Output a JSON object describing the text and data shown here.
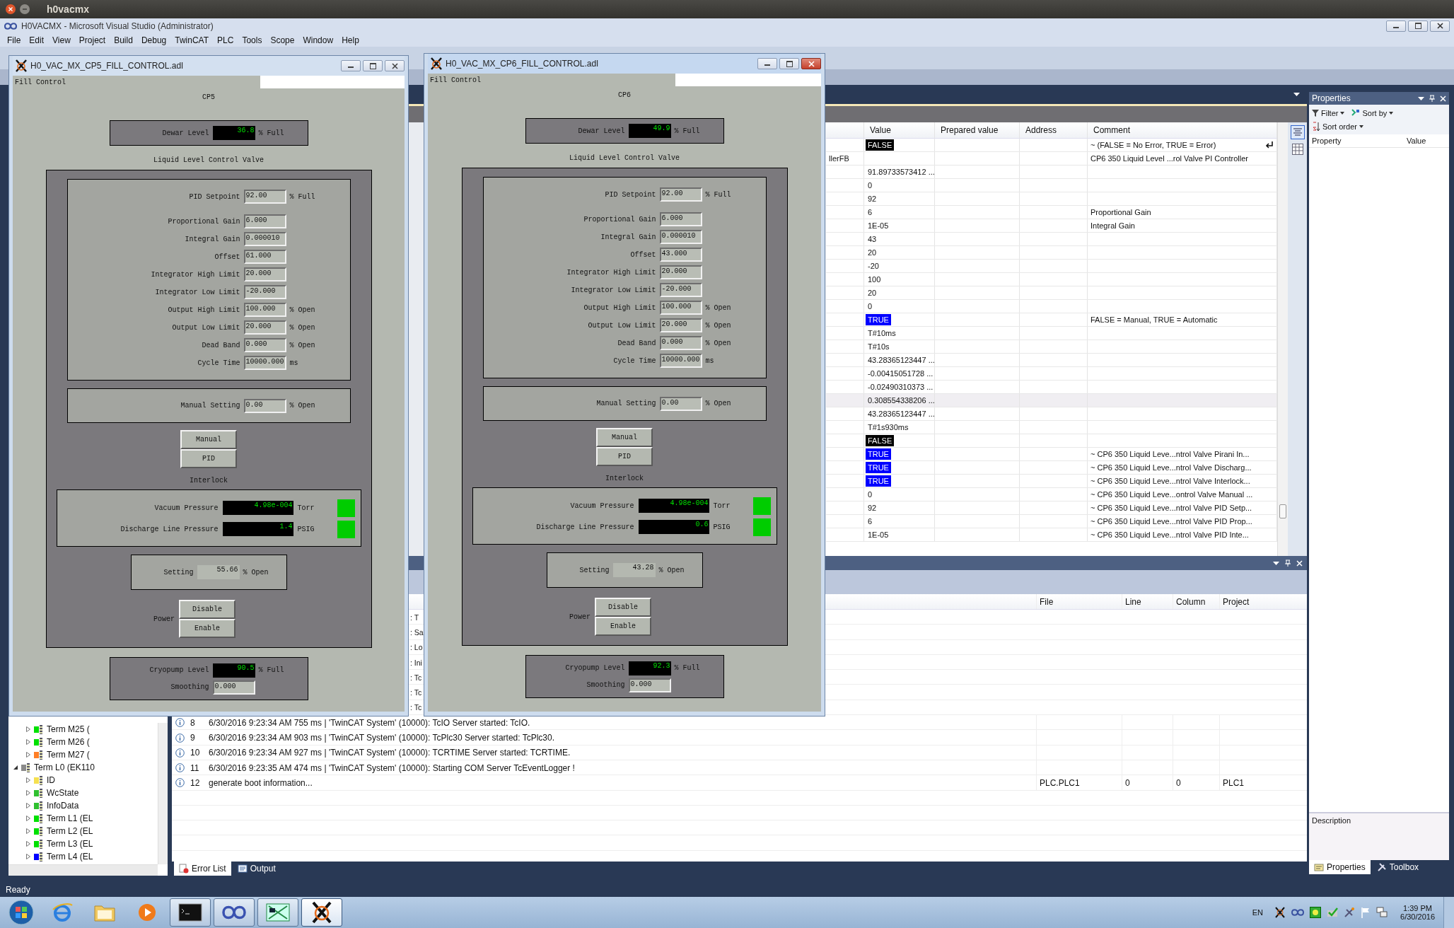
{
  "desktop": {
    "title": "h0vacmx"
  },
  "vs": {
    "title": "H0VACMX - Microsoft Visual Studio (Administrator)",
    "menu": [
      "File",
      "Edit",
      "View",
      "Project",
      "Build",
      "Debug",
      "TwinCAT",
      "PLC",
      "Tools",
      "Scope",
      "Window",
      "Help"
    ]
  },
  "watch": {
    "columns": [
      "Value",
      "Prepared value",
      "Address",
      "Comment"
    ],
    "rows": [
      {
        "value": "FALSE",
        "color": "#000000",
        "comment": "~ (FALSE = No Error, TRUE = Error)",
        "wrapped": true,
        "selected": false
      },
      {
        "column_1": "llerFB",
        "comment": "CP6  350  Liquid  Level  ...rol Valve PI Controller",
        "wrapped": false,
        "selected": false
      },
      {
        "value": "91.89733573412 ...",
        "wrapped": false,
        "selected": false
      },
      {
        "value": "0",
        "wrapped": false,
        "selected": false
      },
      {
        "value": "92",
        "wrapped": false,
        "selected": false
      },
      {
        "value": "6",
        "comment": "Proportional Gain",
        "wrapped": false,
        "selected": false
      },
      {
        "value": "1E-05",
        "comment": "Integral Gain",
        "wrapped": false,
        "selected": false
      },
      {
        "value": "43",
        "wrapped": false,
        "selected": false
      },
      {
        "value": "20",
        "wrapped": false,
        "selected": false
      },
      {
        "value": "-20",
        "wrapped": false,
        "selected": false
      },
      {
        "value": "100",
        "wrapped": false,
        "selected": false
      },
      {
        "value": "20",
        "wrapped": false,
        "selected": false
      },
      {
        "value": "0",
        "wrapped": false,
        "selected": false
      },
      {
        "value": "TRUE",
        "color": "#0000ff",
        "comment": "FALSE = Manual, TRUE = Automatic",
        "wrapped": false,
        "selected": false
      },
      {
        "value": "T#10ms",
        "wrapped": false,
        "selected": false
      },
      {
        "value": "T#10s",
        "wrapped": false,
        "selected": false
      },
      {
        "value": "43.28365123447 ...",
        "wrapped": false,
        "selected": false
      },
      {
        "value": "-0.00415051728 ...",
        "wrapped": false,
        "selected": false
      },
      {
        "value": "-0.02490310373 ...",
        "wrapped": false,
        "selected": false
      },
      {
        "value": "0.308554338206 ...",
        "wrapped": false,
        "selected": true
      },
      {
        "value": "43.28365123447 ...",
        "wrapped": false,
        "selected": false
      },
      {
        "value": "T#1s930ms",
        "wrapped": false,
        "selected": false
      },
      {
        "value": "FALSE",
        "color": "#000000",
        "wrapped": false,
        "selected": false
      },
      {
        "value": "TRUE",
        "color": "#0000ff",
        "comment": "~ CP6 350 Liquid Leve...ntrol Valve Pirani In...",
        "wrapped": false,
        "selected": false
      },
      {
        "value": "TRUE",
        "color": "#0000ff",
        "comment": "~ CP6 350 Liquid Leve...ntrol Valve Discharg...",
        "wrapped": false,
        "selected": false
      },
      {
        "value": "TRUE",
        "color": "#0000ff",
        "comment": "~ CP6 350 Liquid Leve...ntrol Valve Interlock...",
        "wrapped": false,
        "selected": false
      },
      {
        "value": "0",
        "comment": "~ CP6 350 Liquid Leve...ontrol Valve Manual ...",
        "wrapped": false,
        "selected": false
      },
      {
        "value": "92",
        "comment": "~ CP6 350 Liquid Leve...ntrol Valve PID Setp...",
        "wrapped": false,
        "selected": false
      },
      {
        "value": "6",
        "comment": "~ CP6 350 Liquid Leve...ntrol Valve PID Prop...",
        "wrapped": false,
        "selected": false
      },
      {
        "value": "1E-05",
        "comment": "~ CP6 350 Liquid Leve...ntrol Valve PID Inte...",
        "wrapped": false,
        "selected": false
      }
    ]
  },
  "tree": [
    {
      "children": [
        {
          "label": "Term M25 (",
          "expanded": false,
          "color": "#00e000"
        },
        {
          "label": "Term M26 (",
          "expanded": false,
          "color": "#00e000"
        },
        {
          "label": "Term M27 (",
          "expanded": false,
          "color": "#ff7f27"
        }
      ]
    },
    {
      "label": "Term L0 (EK110",
      "expanded": true,
      "color": "#8a8a8a",
      "children": [
        {
          "label": "ID",
          "expanded": false,
          "color": "#f5e050"
        },
        {
          "label": "WcState",
          "expanded": false,
          "color": "#30c030"
        },
        {
          "label": "InfoData",
          "expanded": false,
          "color": "#30c030"
        },
        {
          "label": "Term L1 (EL",
          "expanded": false,
          "color": "#00e000"
        },
        {
          "label": "Term L2 (EL",
          "expanded": false,
          "color": "#00e000"
        },
        {
          "label": "Term L3 (EL",
          "expanded": false,
          "color": "#00e000"
        },
        {
          "label": "Term L4 (EL",
          "expanded": false,
          "color": "#0000ff"
        }
      ]
    }
  ],
  "errors": {
    "columns": [
      "File",
      "Line",
      "Column",
      "Project"
    ],
    "rows": [
      {
        "kind": "partial",
        "text": ": T"
      },
      {
        "kind": "partial",
        "text": ": Sa"
      },
      {
        "kind": "partial",
        "text": ": Lo"
      },
      {
        "kind": "partial",
        "text": ": Ini"
      },
      {
        "kind": "partial",
        "text": ": Tc"
      },
      {
        "kind": "partial",
        "text": ": Tc"
      },
      {
        "kind": "partial",
        "text": ": Tc"
      },
      {
        "kind": "message",
        "number": "8",
        "text": "6/30/2016 9:23:34 AM 755 ms | 'TwinCAT System' (10000): TcIO Server started: TcIO."
      },
      {
        "kind": "message",
        "number": "9",
        "text": "6/30/2016 9:23:34 AM 903 ms | 'TwinCAT System' (10000): TcPlc30 Server started: TcPlc30."
      },
      {
        "kind": "message",
        "number": "10",
        "text": "6/30/2016 9:23:34 AM 927 ms | 'TwinCAT System' (10000): TCRTIME Server started: TCRTIME."
      },
      {
        "kind": "message",
        "number": "11",
        "text": "6/30/2016 9:23:35 AM 474 ms | 'TwinCAT System' (10000): Starting COM Server TcEventLogger !"
      },
      {
        "kind": "message",
        "number": "12",
        "text": "generate boot information...",
        "file": "PLC.PLC1",
        "line": "0",
        "column": "0",
        "project": "PLC1"
      }
    ],
    "tabs": [
      {
        "label": "Error List",
        "selected": true
      },
      {
        "label": "Output",
        "selected": false
      }
    ]
  },
  "properties": {
    "title": "Properties",
    "toolbar": [
      {
        "kind": "filter",
        "label": "Filter"
      },
      {
        "kind": "sort",
        "label": "Sort by"
      },
      {
        "kind": "order",
        "label": "Sort order"
      }
    ],
    "columns": [
      "Property",
      "Value"
    ],
    "description": "Description",
    "tabs": [
      {
        "label": "Properties",
        "selected": true
      },
      {
        "label": "Toolbox",
        "selected": false
      }
    ]
  },
  "status_bar": "Ready",
  "taskbar": {
    "apps": [
      {
        "kind": "browser",
        "running": false,
        "selected": false
      },
      {
        "kind": "folder",
        "running": false,
        "selected": false
      },
      {
        "kind": "media",
        "running": false,
        "selected": false
      },
      {
        "kind": "console",
        "running": true,
        "selected": false
      },
      {
        "kind": "studio",
        "running": true,
        "selected": false
      },
      {
        "kind": "terminal",
        "running": true,
        "selected": false
      },
      {
        "kind": "xwin",
        "running": true,
        "selected": true
      }
    ],
    "language": "EN",
    "time": "1:39 PM",
    "date": "6/30/2016"
  },
  "windows": [
    {
      "title": "H0_VAC_MX_CP5_FILL_CONTROL.adl",
      "active": false,
      "menu": "Fill Control",
      "heading": "CP5",
      "dewar": {
        "label": "Dewar Level",
        "value": "36.8",
        "unit": "% Full"
      },
      "valve_title": "Liquid Level Control Valve",
      "params": [
        {
          "label": "PID Setpoint",
          "value": "92.00",
          "unit": "% Full"
        },
        {
          "label": "Proportional Gain",
          "value": "6.000"
        },
        {
          "label": "Integral Gain",
          "value": "0.000010"
        },
        {
          "label": "Offset",
          "value": "61.000"
        },
        {
          "label": "Integrator High Limit",
          "value": "20.000"
        },
        {
          "label": "Integrator Low Limit",
          "value": "-20.000"
        },
        {
          "label": "Output High Limit",
          "value": "100.000",
          "unit": "% Open"
        },
        {
          "label": "Output Low Limit",
          "value": "20.000",
          "unit": "% Open"
        },
        {
          "label": "Dead Band",
          "value": "0.000",
          "unit": "% Open"
        },
        {
          "label": "Cycle Time",
          "value": "10000.000",
          "unit": "ms"
        }
      ],
      "manual": {
        "label": "Manual Setting",
        "value": "0.00",
        "unit": "% Open"
      },
      "mode_buttons": [
        "Manual",
        "PID"
      ],
      "interlock_title": "Interlock",
      "interlocks": [
        {
          "label": "Vacuum Pressure",
          "value": "4.98e-004",
          "unit": "Torr",
          "color": "#00cc00"
        },
        {
          "label": "Discharge Line Pressure",
          "value": "1.4",
          "unit": "PSIG",
          "color": "#00cc00"
        }
      ],
      "setting": {
        "label": "Setting",
        "value": "55.66",
        "unit": "% Open"
      },
      "power_label": "Power",
      "power_buttons": [
        "Disable",
        "Enable"
      ],
      "cryopump": {
        "label": "Cryopump Level",
        "value": "90.5",
        "unit": "% Full"
      },
      "smoothing": {
        "label": "Smoothing",
        "value": "0.000"
      }
    },
    {
      "title": "H0_VAC_MX_CP6_FILL_CONTROL.adl",
      "active": true,
      "menu": "Fill Control",
      "heading": "CP6",
      "dewar": {
        "label": "Dewar Level",
        "value": "49.9",
        "unit": "% Full"
      },
      "valve_title": "Liquid Level Control Valve",
      "params": [
        {
          "label": "PID Setpoint",
          "value": "92.00",
          "unit": "% Full"
        },
        {
          "label": "Proportional Gain",
          "value": "6.000"
        },
        {
          "label": "Integral Gain",
          "value": "0.000010"
        },
        {
          "label": "Offset",
          "value": "43.000"
        },
        {
          "label": "Integrator High Limit",
          "value": "20.000"
        },
        {
          "label": "Integrator Low Limit",
          "value": "-20.000"
        },
        {
          "label": "Output High Limit",
          "value": "100.000",
          "unit": "% Open"
        },
        {
          "label": "Output Low Limit",
          "value": "20.000",
          "unit": "% Open"
        },
        {
          "label": "Dead Band",
          "value": "0.000",
          "unit": "% Open"
        },
        {
          "label": "Cycle Time",
          "value": "10000.000",
          "unit": "ms"
        }
      ],
      "manual": {
        "label": "Manual Setting",
        "value": "0.00",
        "unit": "% Open"
      },
      "mode_buttons": [
        "Manual",
        "PID"
      ],
      "interlock_title": "Interlock",
      "interlocks": [
        {
          "label": "Vacuum Pressure",
          "value": "4.98e-004",
          "unit": "Torr",
          "color": "#00cc00"
        },
        {
          "label": "Discharge Line Pressure",
          "value": "0.6",
          "unit": "PSIG",
          "color": "#00cc00"
        }
      ],
      "setting": {
        "label": "Setting",
        "value": "43.28",
        "unit": "% Open"
      },
      "power_label": "Power",
      "power_buttons": [
        "Disable",
        "Enable"
      ],
      "cryopump": {
        "label": "Cryopump Level",
        "value": "92.3",
        "unit": "% Full"
      },
      "smoothing": {
        "label": "Smoothing",
        "value": "0.000"
      }
    }
  ]
}
